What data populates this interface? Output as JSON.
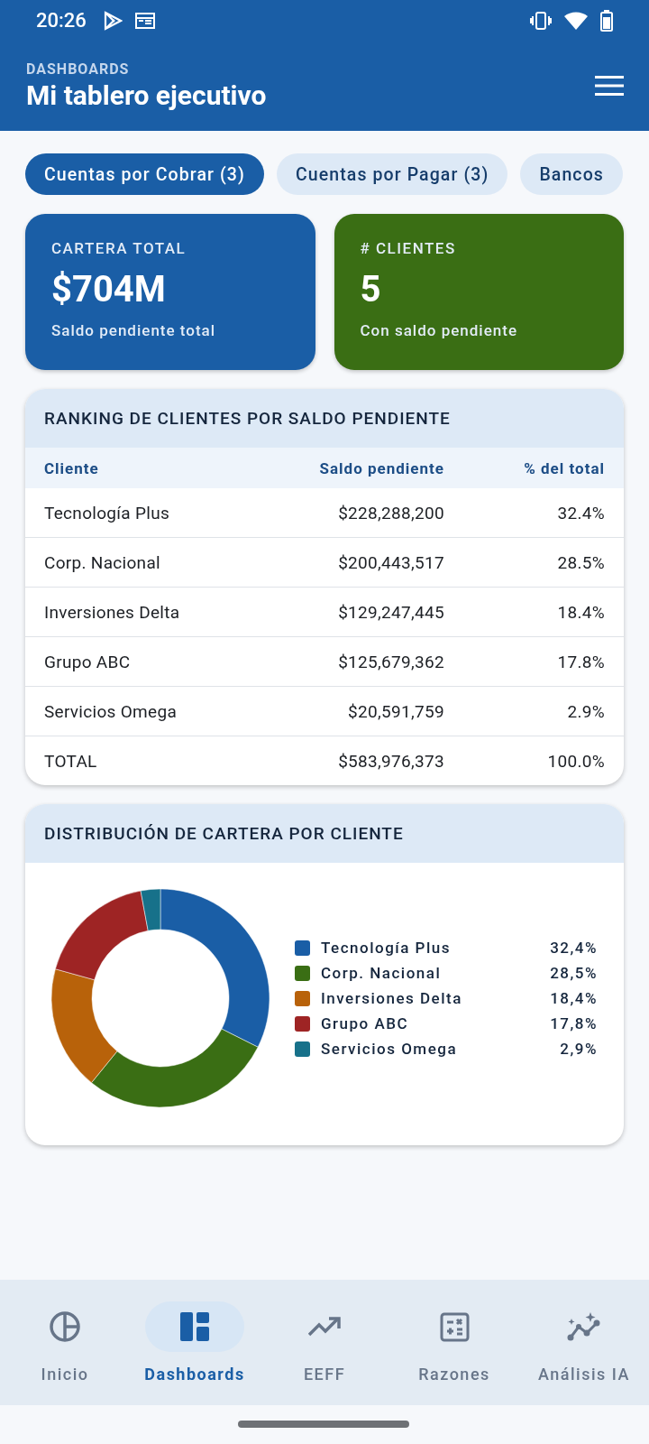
{
  "status_bar": {
    "time": "20:26"
  },
  "app_bar": {
    "overline": "DASHBOARDS",
    "title": "Mi tablero ejecutivo"
  },
  "tabs": [
    {
      "label": "Cuentas por Cobrar (3)",
      "selected": true
    },
    {
      "label": "Cuentas por Pagar (3)",
      "selected": false
    },
    {
      "label": "Bancos",
      "selected": false
    }
  ],
  "kpis": [
    {
      "label": "CARTERA TOTAL",
      "value": "$704M",
      "caption": "Saldo pendiente total",
      "color": "#1a5ea6"
    },
    {
      "label": "# CLIENTES",
      "value": "5",
      "caption": "Con saldo pendiente",
      "color": "#3a6e14"
    }
  ],
  "ranking": {
    "title": "RANKING DE CLIENTES POR SALDO PENDIENTE",
    "columns": [
      "Cliente",
      "Saldo pendiente",
      "% del total"
    ],
    "rows": [
      [
        "Tecnología Plus",
        "$228,288,200",
        "32.4%"
      ],
      [
        "Corp. Nacional",
        "$200,443,517",
        "28.5%"
      ],
      [
        "Inversiones Delta",
        "$129,247,445",
        "18.4%"
      ],
      [
        "Grupo ABC",
        "$125,679,362",
        "17.8%"
      ],
      [
        "Servicios Omega",
        "$20,591,759",
        "2.9%"
      ],
      [
        "TOTAL",
        "$583,976,373",
        "100.0%"
      ]
    ]
  },
  "distribution": {
    "title": "DISTRIBUCIÓN DE CARTERA POR CLIENTE",
    "chart_data": {
      "type": "donut",
      "categories": [
        "Tecnología Plus",
        "Corp. Nacional",
        "Inversiones Delta",
        "Grupo ABC",
        "Servicios Omega"
      ],
      "values": [
        32.4,
        28.5,
        18.4,
        17.8,
        2.9
      ]
    },
    "legend": [
      {
        "value": "32,4%",
        "color": "#1a5ea6"
      },
      {
        "value": "28,5%",
        "color": "#3a6e14"
      },
      {
        "value": "18,4%",
        "color": "#b8620a"
      },
      {
        "value": "17,8%",
        "color": "#9e2424"
      },
      {
        "value": "2,9%",
        "color": "#17718a"
      }
    ]
  },
  "bottom_nav": [
    {
      "label": "Inicio",
      "selected": false
    },
    {
      "label": "Dashboards",
      "selected": true
    },
    {
      "label": "EEFF",
      "selected": false
    },
    {
      "label": "Razones",
      "selected": false
    },
    {
      "label": "Análisis IA",
      "selected": false
    }
  ]
}
